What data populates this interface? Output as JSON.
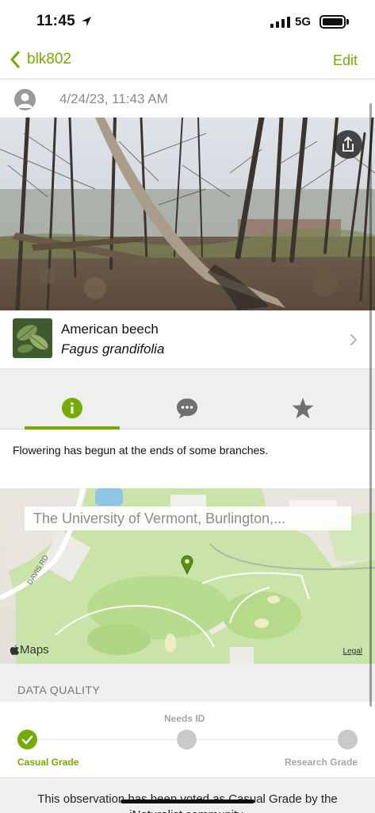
{
  "status_bar": {
    "time": "11:45",
    "network": "5G",
    "location_icon": "location-arrow-icon",
    "signal_icon": "signal-bars-icon",
    "battery_icon": "battery-icon"
  },
  "nav": {
    "back_label": "blk802",
    "edit_label": "Edit",
    "back_icon": "chevron-left-icon"
  },
  "observation": {
    "date": "4/24/23, 11:43 AM",
    "photo_description_icon": "share-icon"
  },
  "taxon": {
    "common_name": "American beech",
    "scientific_name": "Fagus grandifolia"
  },
  "tabs": [
    {
      "name": "info",
      "icon": "info-icon",
      "active": true
    },
    {
      "name": "activity",
      "icon": "speech-bubble-icon",
      "active": false
    },
    {
      "name": "favorites",
      "icon": "star-icon",
      "active": false
    }
  ],
  "description": "Flowering has begun at the ends of some branches.",
  "map": {
    "place": "The University of Vermont, Burlington,...",
    "brand": "Maps",
    "legal": "Legal",
    "road_label": "DAVIS RD"
  },
  "data_quality": {
    "header": "DATA QUALITY",
    "levels": [
      "Casual Grade",
      "Needs ID",
      "Research Grade"
    ],
    "current": "Casual Grade",
    "footer": "This observation has been voted as Casual Grade by the iNaturalist community."
  },
  "colors": {
    "accent": "#74ac00",
    "inactive_dot": "#c9c9c9",
    "section_bg": "#efeff0"
  }
}
